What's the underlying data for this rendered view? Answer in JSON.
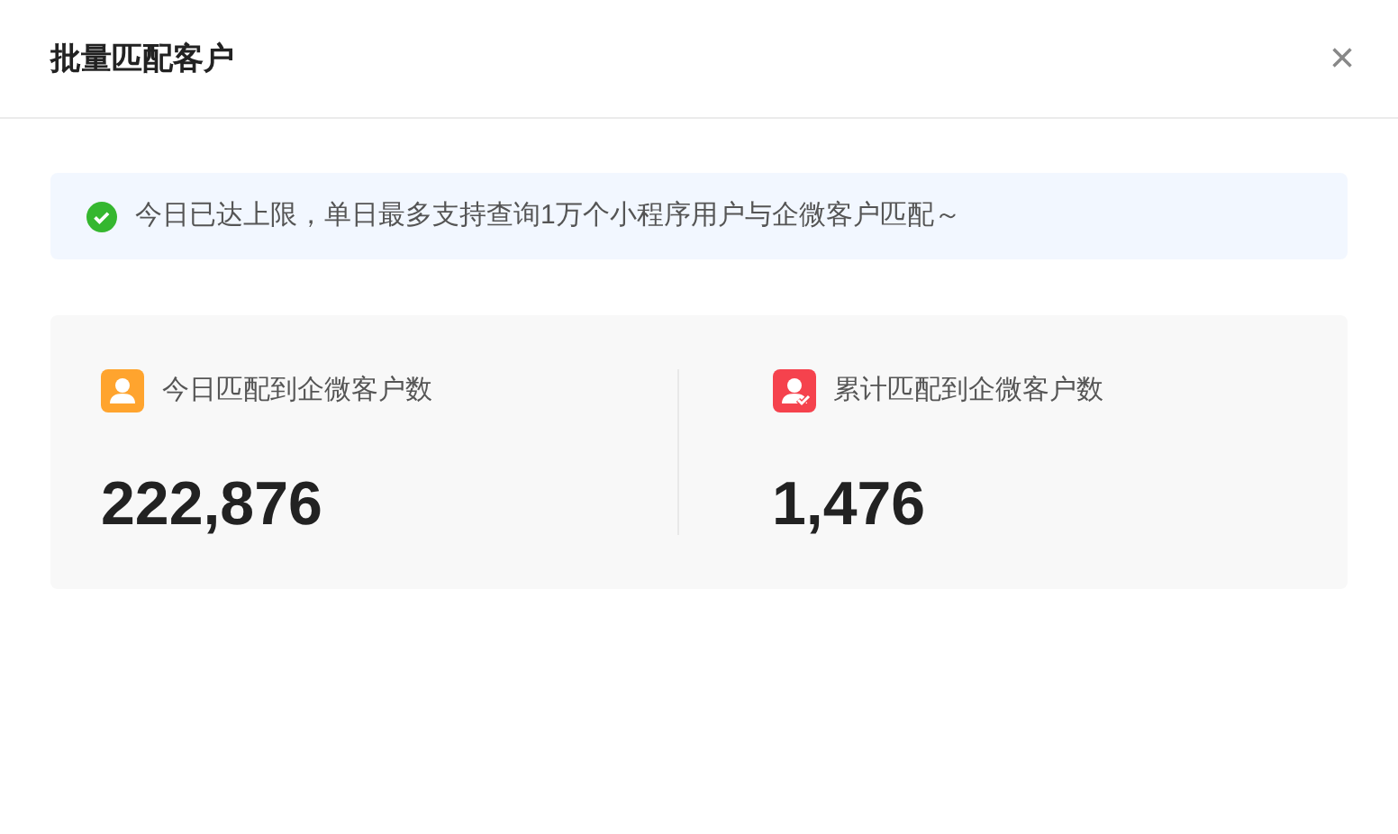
{
  "dialog": {
    "title": "批量匹配客户",
    "close": "×"
  },
  "notice": {
    "text": "今日已达上限，单日最多支持查询1万个小程序用户与企微客户匹配～"
  },
  "stats": [
    {
      "kind": "user",
      "label": "今日匹配到企微客户数",
      "value": "222,876",
      "color": "#ffa42e"
    },
    {
      "kind": "verified",
      "label": "累计匹配到企微客户数",
      "value": "1,476",
      "color": "#f5424d"
    }
  ]
}
